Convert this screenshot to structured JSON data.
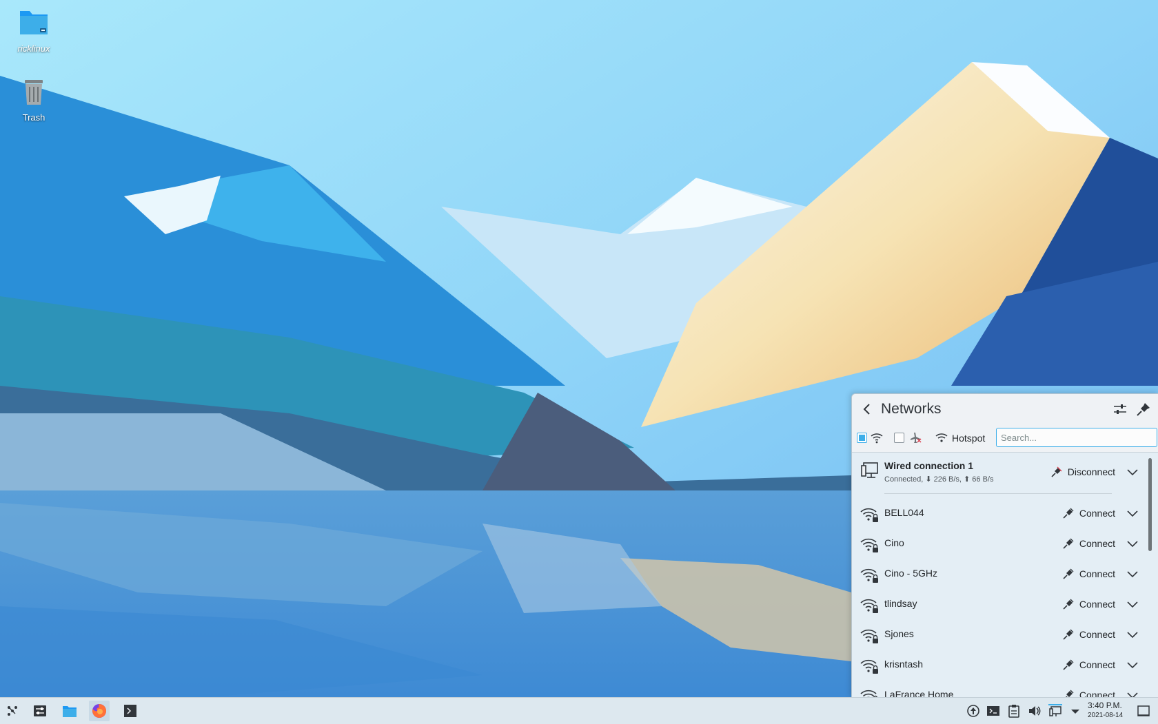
{
  "desktop": {
    "icons": [
      {
        "label": "ricklinux",
        "icon": "home-folder-icon"
      },
      {
        "label": "Trash",
        "icon": "trash-icon"
      }
    ]
  },
  "networks_popup": {
    "title": "Networks",
    "toolbar": {
      "wifi_enabled": true,
      "airplane_mode": false,
      "hotspot_label": "Hotspot",
      "search_placeholder": "Search..."
    },
    "wired": {
      "name": "Wired connection 1",
      "status": "Connected, ⬇ 226 B/s, ⬆ 66 B/s",
      "action": "Disconnect"
    },
    "wifi": [
      {
        "name": "BELL044",
        "action": "Connect"
      },
      {
        "name": "Cino",
        "action": "Connect"
      },
      {
        "name": "Cino - 5GHz",
        "action": "Connect"
      },
      {
        "name": "tlindsay",
        "action": "Connect"
      },
      {
        "name": "Sjones",
        "action": "Connect"
      },
      {
        "name": "krisntash",
        "action": "Connect"
      },
      {
        "name": "LaFrance Home",
        "action": "Connect"
      }
    ]
  },
  "taskbar": {
    "clock_time": "3:40 P.M.",
    "clock_date": "2021-08-14"
  },
  "colors": {
    "accent": "#3daee9",
    "panel_bg": "#e4eef5",
    "taskbar_bg": "#dde8ef"
  }
}
